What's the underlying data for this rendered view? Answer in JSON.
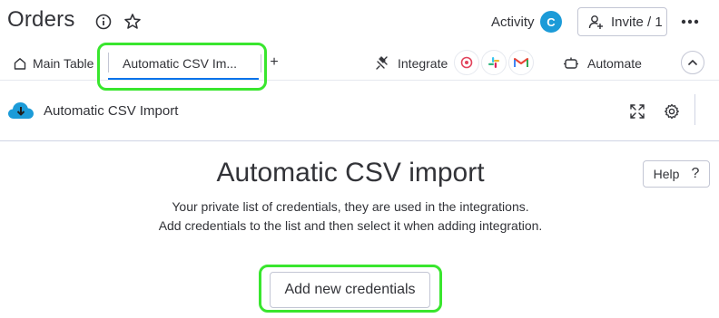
{
  "header": {
    "title": "Orders",
    "activity_label": "Activity",
    "avatar_initial": "C",
    "avatar_color": "#1c9bd8",
    "invite_label": "Invite / 1"
  },
  "tabs": {
    "main_label": "Main Table",
    "active_label": "Automatic CSV Im...",
    "add_label": "+",
    "integrate_label": "Integrate",
    "integration_apps": [
      "webhooks-icon",
      "slack-icon",
      "gmail-icon"
    ],
    "automate_label": "Automate"
  },
  "widget": {
    "title": "Automatic CSV Import"
  },
  "main": {
    "heading": "Automatic CSV import",
    "description_line1": "Your private list of credentials, they are used in the integrations.",
    "description_line2": "Add credentials to the list and then select it when adding integration.",
    "help_label": "Help",
    "help_icon": "?",
    "add_button_label": "Add new credentials"
  },
  "colors": {
    "accent": "#0073ea",
    "highlight": "#39e62e",
    "text": "#323338"
  }
}
